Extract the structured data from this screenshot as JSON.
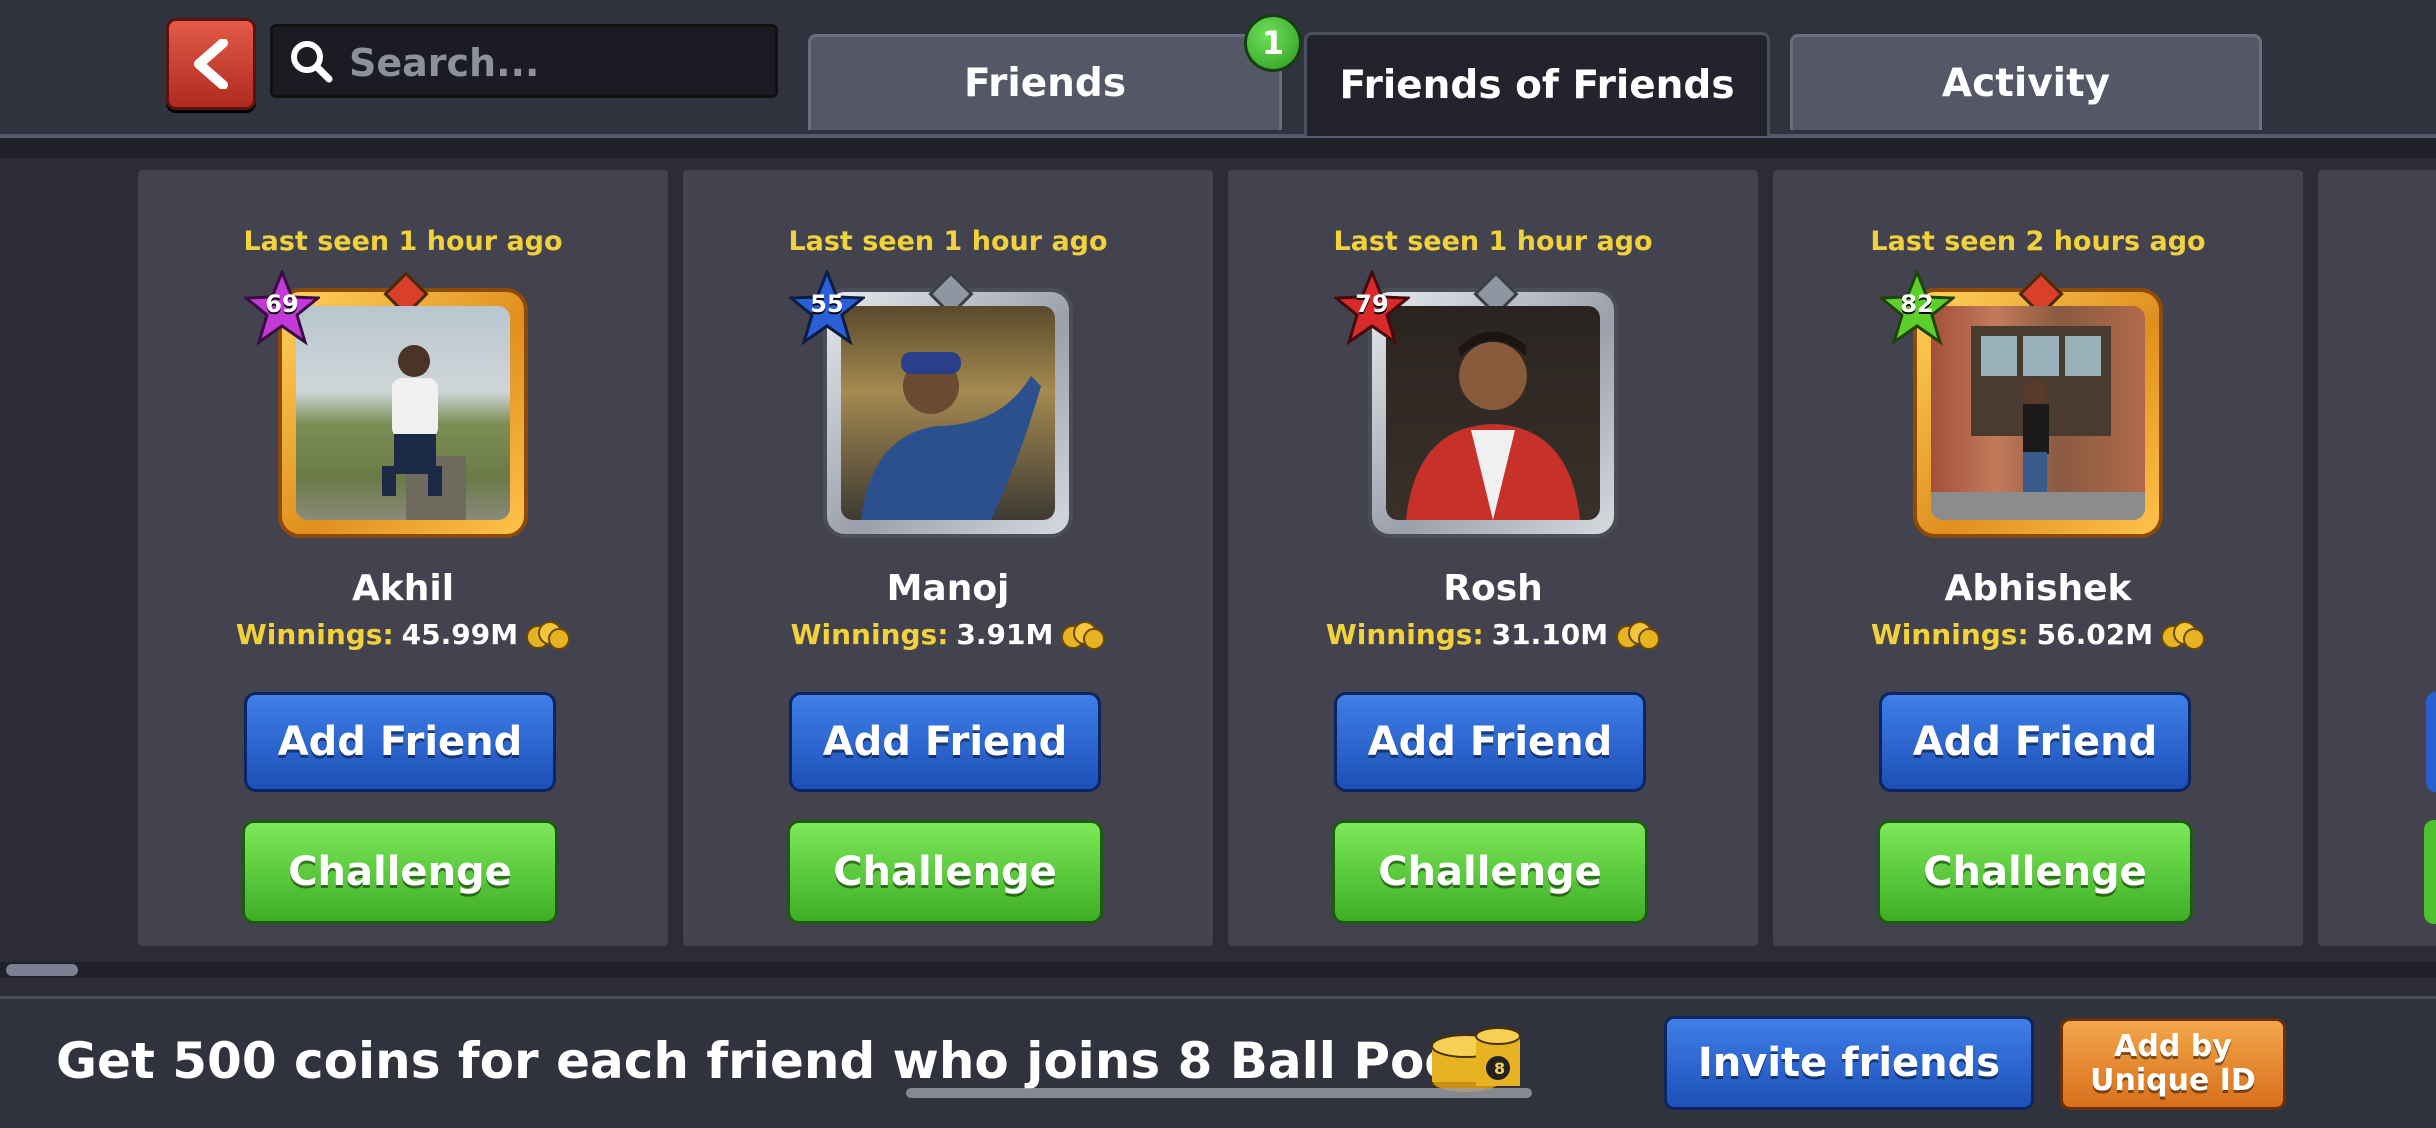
{
  "header": {
    "search_placeholder": "Search...",
    "tabs": [
      {
        "label": "Friends",
        "active": false
      },
      {
        "label": "Friends of Friends",
        "active": true
      },
      {
        "label": "Activity",
        "active": false
      }
    ],
    "notification_badge": "1"
  },
  "players": [
    {
      "last_seen": "Last seen 1 hour ago",
      "level": "69",
      "star_color": "#c23ad6",
      "frame": "gold",
      "name": "Akhil",
      "winnings_label": "Winnings:",
      "winnings": "45.99M",
      "add_friend": "Add Friend",
      "challenge": "Challenge"
    },
    {
      "last_seen": "Last seen 1 hour ago",
      "level": "55",
      "star_color": "#2a5fd6",
      "frame": "silver",
      "name": "Manoj",
      "winnings_label": "Winnings:",
      "winnings": "3.91M",
      "add_friend": "Add Friend",
      "challenge": "Challenge"
    },
    {
      "last_seen": "Last seen 1 hour ago",
      "level": "79",
      "star_color": "#d82a2a",
      "frame": "silver",
      "name": "Rosh",
      "winnings_label": "Winnings:",
      "winnings": "31.10M",
      "add_friend": "Add Friend",
      "challenge": "Challenge"
    },
    {
      "last_seen": "Last seen 2 hours ago",
      "level": "82",
      "star_color": "#5ccf2a",
      "frame": "gold",
      "name": "Abhishek",
      "winnings_label": "Winnings:",
      "winnings": "56.02M",
      "add_friend": "Add Friend",
      "challenge": "Challenge"
    }
  ],
  "footer": {
    "promo": "Get 500 coins for each friend who joins 8 Ball Pool!",
    "invite": "Invite friends",
    "add_by_id_line1": "Add by",
    "add_by_id_line2": "Unique ID"
  },
  "colors": {
    "accent_yellow": "#f2d23c",
    "button_blue": "#2a62d0",
    "button_green": "#4fc12e",
    "button_orange": "#e58a2e",
    "back_red": "#c8392b"
  }
}
